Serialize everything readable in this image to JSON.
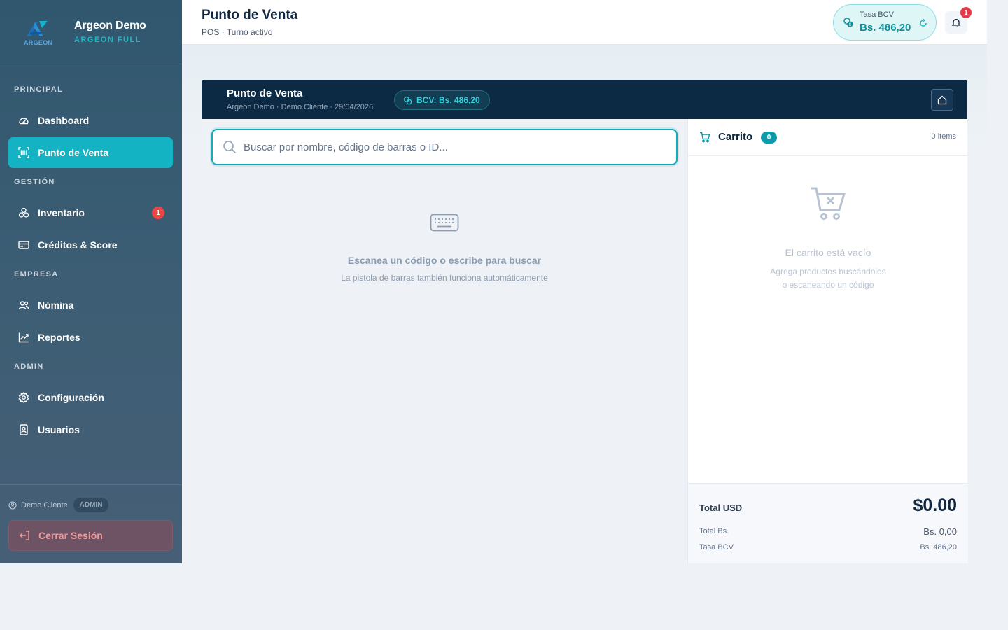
{
  "brand": {
    "name": "Argeon Demo",
    "plan": "ARGEON FULL",
    "logo_text": "ARGEON"
  },
  "nav": {
    "sections": [
      "PRINCIPAL",
      "GESTIÓN",
      "EMPRESA",
      "ADMIN"
    ],
    "items": [
      {
        "label": "Dashboard",
        "icon": "gauge-icon"
      },
      {
        "label": "Punto de Venta",
        "icon": "barcode-scan-icon",
        "active": true
      },
      {
        "label": "Inventario",
        "icon": "boxes-icon",
        "badge": "1"
      },
      {
        "label": "Créditos & Score",
        "icon": "credit-card-icon"
      },
      {
        "label": "Nómina",
        "icon": "users-icon"
      },
      {
        "label": "Reportes",
        "icon": "chart-line-icon"
      },
      {
        "label": "Configuración",
        "icon": "gear-icon"
      },
      {
        "label": "Usuarios",
        "icon": "id-badge-icon"
      }
    ]
  },
  "user": {
    "name": "Demo Cliente",
    "role": "ADMIN",
    "logout_label": "Cerrar Sesión"
  },
  "topbar": {
    "title": "Punto de Venta",
    "subtitle": "POS · Turno activo",
    "rate_label": "Tasa BCV",
    "rate_value": "Bs. 486,20",
    "notifications": "1"
  },
  "pos": {
    "title": "Punto de Venta",
    "subtitle": "Argeon Demo · Demo Cliente · 29/04/2026",
    "bcv_chip": "BCV: Bs. 486,20",
    "search_placeholder": "Buscar por nombre, código de barras o ID...",
    "empty_title": "Escanea un código o escribe para buscar",
    "empty_sub": "La pistola de barras también funciona automáticamente"
  },
  "cart": {
    "title": "Carrito",
    "count": "0",
    "items_label": "0 items",
    "empty_title": "El carrito está vacío",
    "empty_sub_1": "Agrega productos buscándolos",
    "empty_sub_2": "o escaneando un código",
    "total_usd_label": "Total USD",
    "total_usd": "$0.00",
    "total_bs_label": "Total Bs.",
    "total_bs": "Bs. 0,00",
    "rate_label": "Tasa BCV",
    "rate_value": "Bs. 486,20"
  },
  "colors": {
    "accent": "#14b3c3",
    "sidebar": "#3b5d74",
    "header": "#0d2a45",
    "danger": "#ef4444"
  }
}
